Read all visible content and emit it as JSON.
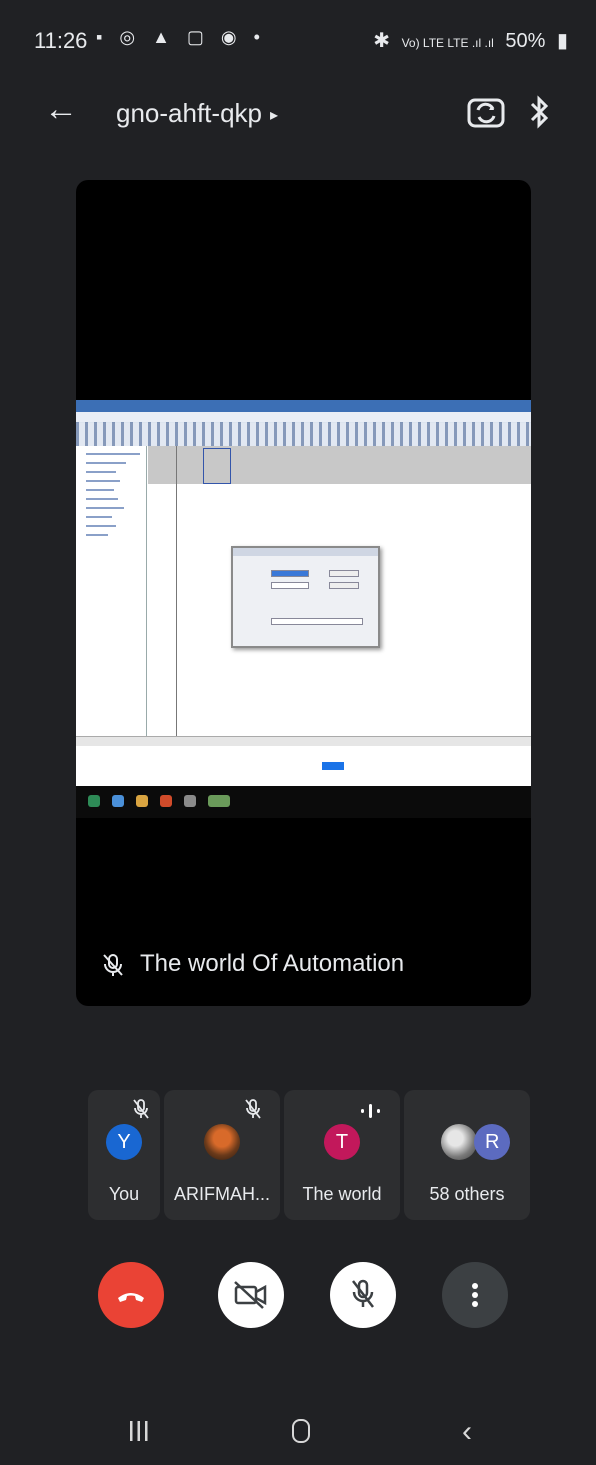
{
  "status_bar": {
    "time": "11:26",
    "notification_icons": "▪ ◎ ▲ ▢ ◉ •",
    "signal_text": "Vo) LTE LTE .ıl .ıl",
    "battery": "50%"
  },
  "top_bar": {
    "meeting_code": "gno-ahft-qkp",
    "chevron": "▸"
  },
  "main_tile": {
    "presenter_name": "The world Of Automation"
  },
  "participants": [
    {
      "name": "You",
      "avatar_letter": "Y",
      "avatar_color": "#1967d2",
      "muted": true
    },
    {
      "name": "ARIFMAH...",
      "avatar_letter": "",
      "avatar_color": "#6b3a1a",
      "muted": true
    },
    {
      "name": "The world",
      "avatar_letter": "T",
      "avatar_color": "#c2185b",
      "speaking": true
    },
    {
      "name": "58 others",
      "avatar_letter": "R",
      "avatar_color": "#5c6bc0"
    }
  ],
  "controls": {
    "end_call_color": "#ea4335"
  }
}
